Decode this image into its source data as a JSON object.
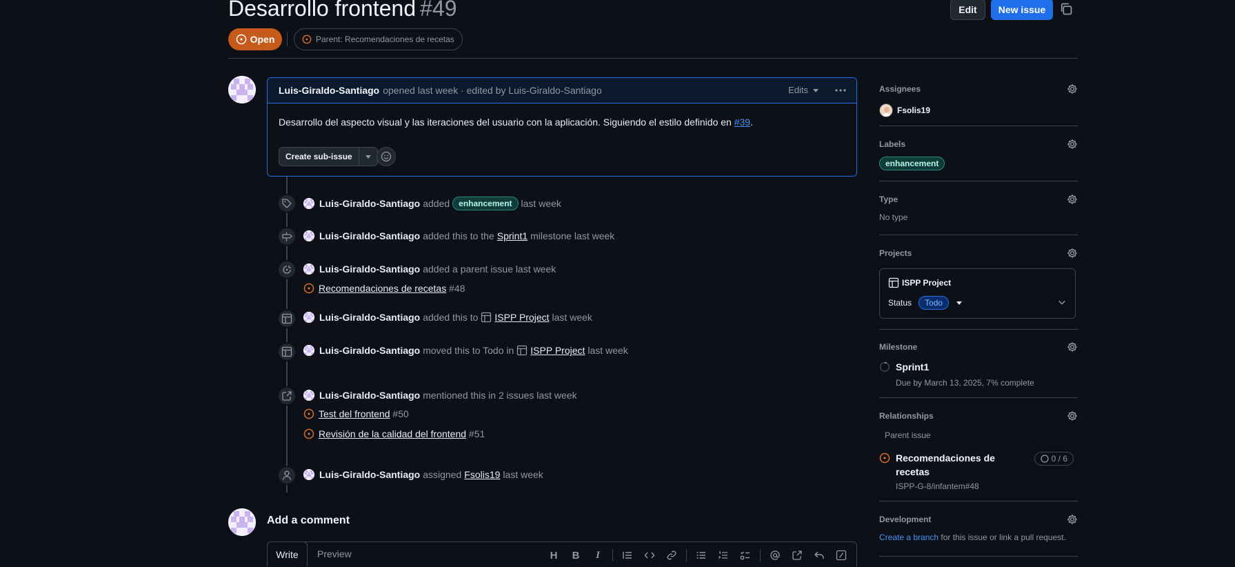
{
  "header": {
    "title": "Desarrollo frontend",
    "number": "#49",
    "edit_label": "Edit",
    "new_issue_label": "New issue",
    "state": "Open",
    "parent_label": "Parent: Recomendaciones de recetas"
  },
  "comment": {
    "author": "Luis-Giraldo-Santiago",
    "meta": "opened last week · edited by Luis-Giraldo-Santiago",
    "edits_label": "Edits",
    "body_text": "Desarrollo del aspecto visual y las iteraciones del usuario con la aplicación. Siguiendo el estilo definido en",
    "body_ref": "#39",
    "body_end": ".",
    "create_sub_issue": "Create sub-issue"
  },
  "timeline": {
    "e1": {
      "who": "Luis-Giraldo-Santiago",
      "pre": "added",
      "label": "enhancement",
      "post": "last week"
    },
    "e2": {
      "who": "Luis-Giraldo-Santiago",
      "pre": "added this to the",
      "link": "Sprint1",
      "post": "milestone last week"
    },
    "e3": {
      "who": "Luis-Giraldo-Santiago",
      "pre": "added a parent issue last week",
      "ref_title": "Recomendaciones de recetas",
      "ref_num": "#48"
    },
    "e4": {
      "who": "Luis-Giraldo-Santiago",
      "pre": "added this to",
      "link": "ISPP Project",
      "post": "last week"
    },
    "e5": {
      "who": "Luis-Giraldo-Santiago",
      "pre": "moved this to Todo in",
      "link": "ISPP Project",
      "post": "last week"
    },
    "e6": {
      "who": "Luis-Giraldo-Santiago",
      "pre": "mentioned this in 2 issues last week",
      "ref1_title": "Test del frontend",
      "ref1_num": "#50",
      "ref2_title": "Revisión de la calidad del frontend",
      "ref2_num": "#51"
    },
    "e7": {
      "who": "Luis-Giraldo-Santiago",
      "pre": "assigned",
      "link": "Fsolis19",
      "post": "last week"
    }
  },
  "add_comment": {
    "title": "Add a comment",
    "write_tab": "Write",
    "preview_tab": "Preview",
    "toolbar_icons": [
      "heading-icon",
      "bold-icon",
      "italic-icon",
      "quote-icon",
      "code-icon",
      "link-icon",
      "unordered-list-icon",
      "ordered-list-icon",
      "task-list-icon",
      "mention-icon",
      "reference-icon",
      "reply-icon",
      "slash-icon"
    ]
  },
  "sidebar": {
    "assignees": {
      "heading": "Assignees",
      "user": "Fsolis19"
    },
    "labels": {
      "heading": "Labels",
      "label": "enhancement"
    },
    "type": {
      "heading": "Type",
      "value": "No type"
    },
    "projects": {
      "heading": "Projects",
      "project_name": "ISPP Project",
      "status_label": "Status",
      "status_value": "Todo"
    },
    "milestone": {
      "heading": "Milestone",
      "name": "Sprint1",
      "due": "Due by March 13, 2025, 7% complete"
    },
    "relationships": {
      "heading": "Relationships",
      "parent_heading": "Parent issue",
      "parent_title": "Recomendaciones de recetas",
      "parent_ref": "ISPP-G-8/infantem#48",
      "count": "0 / 6"
    },
    "development": {
      "heading": "Development",
      "link": "Create a branch",
      "rest": "for this issue or link a pull request."
    }
  },
  "colors": {
    "accent": "#1f6feb",
    "open": "#c55a1a",
    "issue_open_icon": "#db6d28",
    "label_bg": "#0f3b3b"
  }
}
